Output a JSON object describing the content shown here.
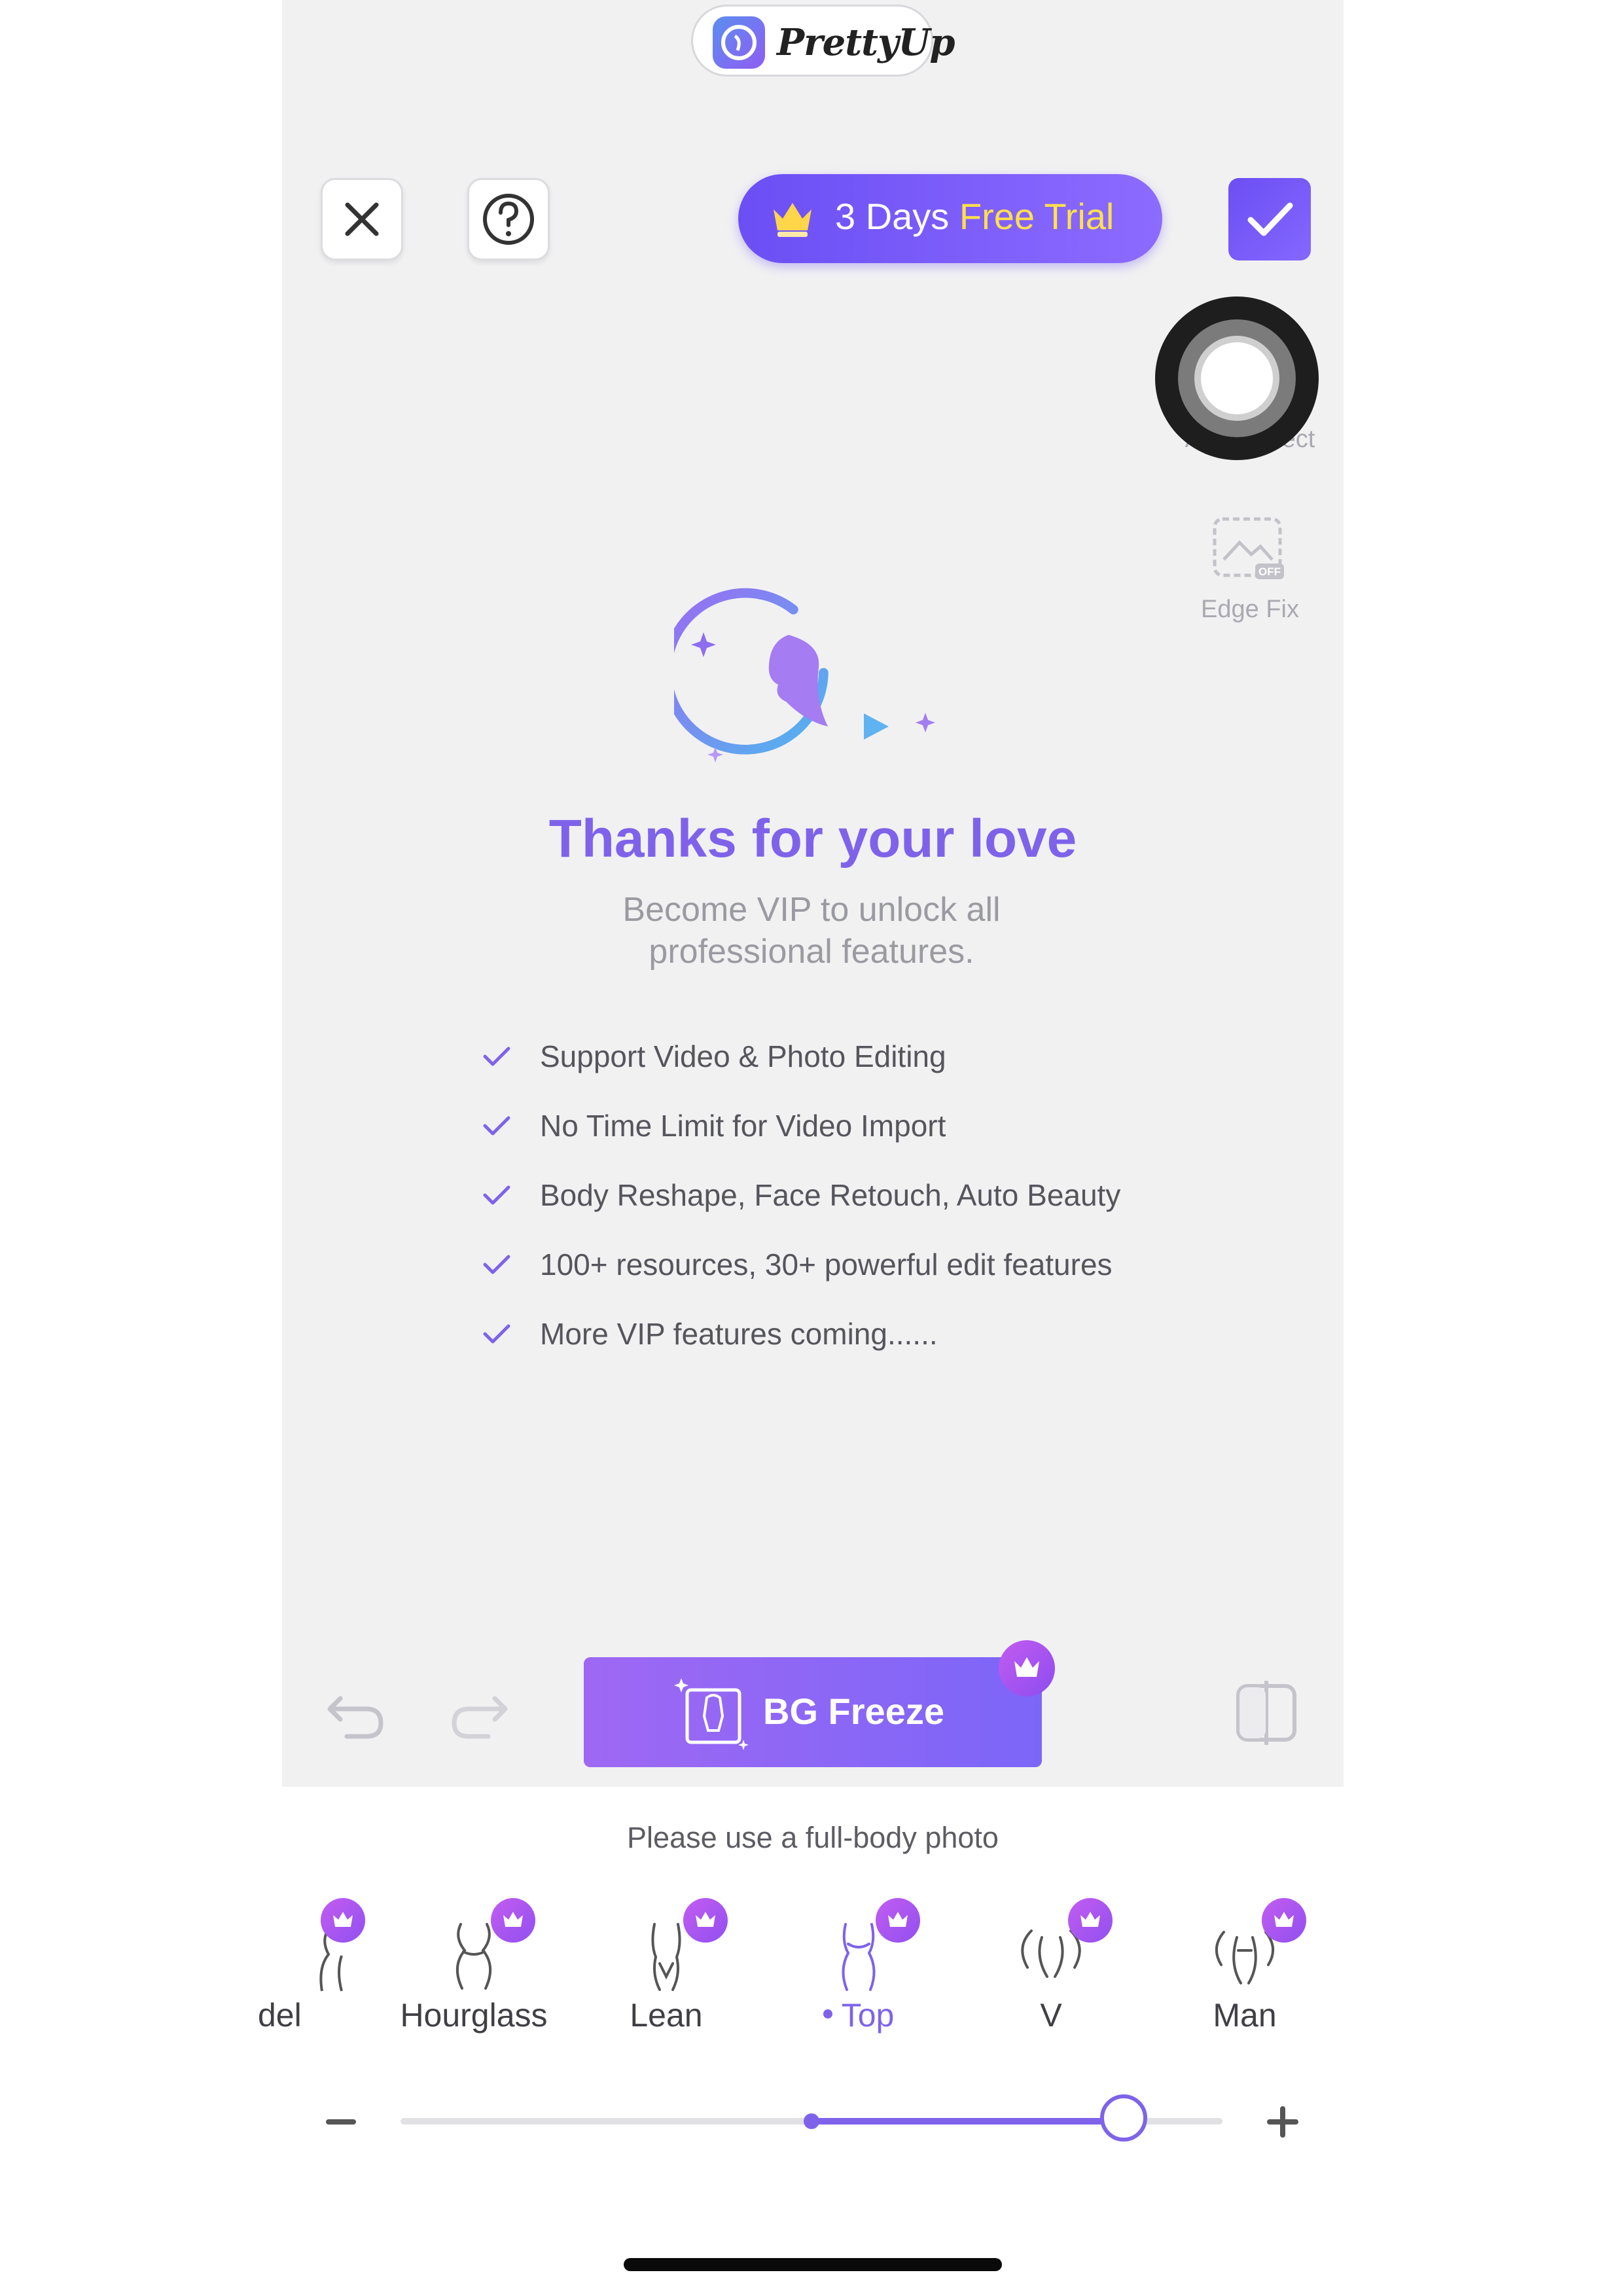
{
  "brand": {
    "name": "PrettyUp",
    "icon": "prettyup-logo-icon"
  },
  "toolbar": {
    "close_icon": "close-icon",
    "help_icon": "help-icon",
    "trial_prefix": "3 Days",
    "trial_highlight": "Free Trial",
    "trial_icon": "crown-icon",
    "confirm_icon": "check-icon"
  },
  "side_tools": {
    "auto_detect_label": "Auto Detect",
    "edge_fix_label": "Edge Fix",
    "edge_fix_badge": "OFF"
  },
  "promo": {
    "title": "Thanks for your love",
    "subtitle": "Become VIP to unlock all professional features.",
    "features": [
      "Support Video & Photo Editing",
      "No Time Limit for Video Import",
      "Body Reshape, Face Retouch, Auto Beauty",
      "100+ resources, 30+ powerful edit features",
      "More VIP features coming......"
    ]
  },
  "actions": {
    "undo_icon": "undo-icon",
    "redo_icon": "redo-icon",
    "bg_freeze_label": "BG Freeze",
    "compare_icon": "compare-icon"
  },
  "hint": "Please use a full-body photo",
  "presets": [
    {
      "label": "del",
      "icon": "model-body-icon",
      "vip": true,
      "active": false
    },
    {
      "label": "Hourglass",
      "icon": "hourglass-body-icon",
      "vip": true,
      "active": false
    },
    {
      "label": "Lean",
      "icon": "lean-body-icon",
      "vip": true,
      "active": false
    },
    {
      "label": "Top",
      "icon": "top-body-icon",
      "vip": true,
      "active": true
    },
    {
      "label": "V",
      "icon": "v-body-icon",
      "vip": true,
      "active": false
    },
    {
      "label": "Man",
      "icon": "man-body-icon",
      "vip": true,
      "active": false
    }
  ],
  "slider": {
    "value": 0.88,
    "origin": 0.5,
    "minus": "−",
    "plus": "+"
  },
  "colors": {
    "accent": "#7e63ea",
    "trial_highlight": "#ffe04a",
    "vip_badge": "#b65af0"
  }
}
